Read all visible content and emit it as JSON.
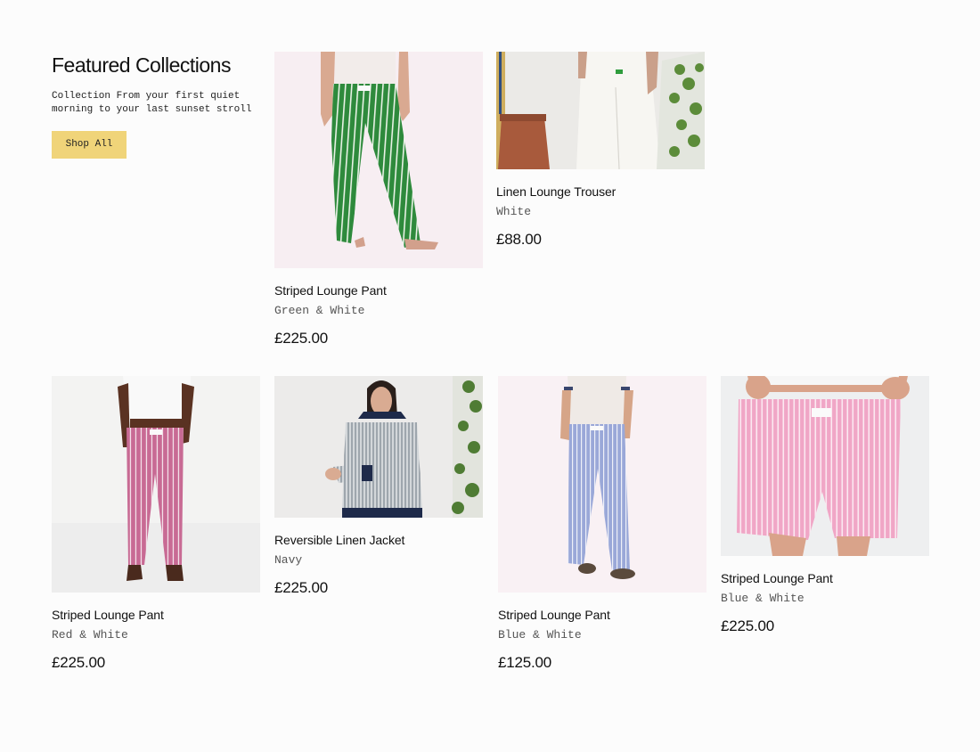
{
  "intro": {
    "heading": "Featured Collections",
    "description": "Collection From your first quiet morning to your last sunset stroll",
    "button_label": "Shop All"
  },
  "products": [
    {
      "title": "Striped Lounge Pant",
      "variant": "Green & White",
      "price": "£225.00",
      "image": "green-striped-pant-photo"
    },
    {
      "title": "Linen Lounge Trouser",
      "variant": "White",
      "price": "£88.00",
      "image": "white-linen-trouser-photo"
    },
    {
      "title": "Striped Lounge Pant",
      "variant": "Red & White",
      "price": "£225.00",
      "image": "red-striped-pant-photo"
    },
    {
      "title": "Reversible Linen Jacket",
      "variant": "Navy",
      "price": "£225.00",
      "image": "linen-jacket-photo"
    },
    {
      "title": "Striped Lounge Pant",
      "variant": "Blue & White",
      "price": "£125.00",
      "image": "blue-striped-pant-photo"
    },
    {
      "title": "Striped Lounge Pant",
      "variant": "Blue & White",
      "price": "£225.00",
      "image": "pink-striped-shorts-photo"
    }
  ]
}
